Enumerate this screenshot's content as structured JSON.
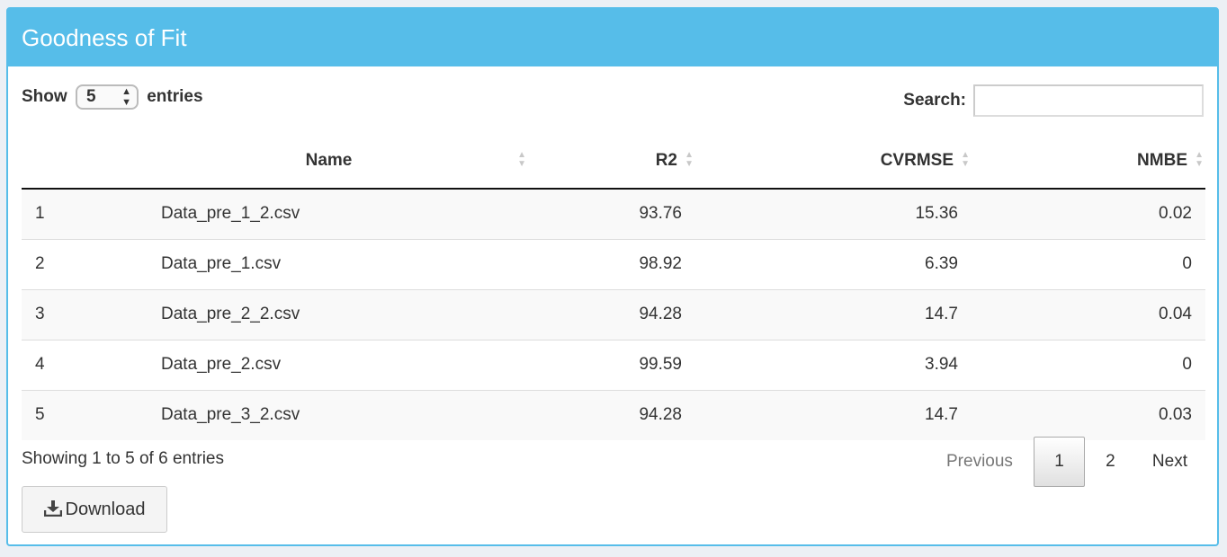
{
  "box": {
    "title": "Goodness of Fit"
  },
  "length": {
    "show_label": "Show",
    "value": "5",
    "entries_label": "entries"
  },
  "search": {
    "label": "Search:",
    "value": ""
  },
  "table": {
    "columns": [
      "",
      "Name",
      "R2",
      "CVRMSE",
      "NMBE"
    ],
    "rows": [
      [
        "1",
        "Data_pre_1_2.csv",
        "93.76",
        "15.36",
        "0.02"
      ],
      [
        "2",
        "Data_pre_1.csv",
        "98.92",
        "6.39",
        "0"
      ],
      [
        "3",
        "Data_pre_2_2.csv",
        "94.28",
        "14.7",
        "0.04"
      ],
      [
        "4",
        "Data_pre_2.csv",
        "99.59",
        "3.94",
        "0"
      ],
      [
        "5",
        "Data_pre_3_2.csv",
        "94.28",
        "14.7",
        "0.03"
      ]
    ]
  },
  "info": "Showing 1 to 5 of 6 entries",
  "pagination": {
    "previous": "Previous",
    "pages": [
      "1",
      "2"
    ],
    "current": "1",
    "next": "Next"
  },
  "download": {
    "label": "Download",
    "icon": "download-icon"
  },
  "colors": {
    "header": "#56bde9"
  }
}
